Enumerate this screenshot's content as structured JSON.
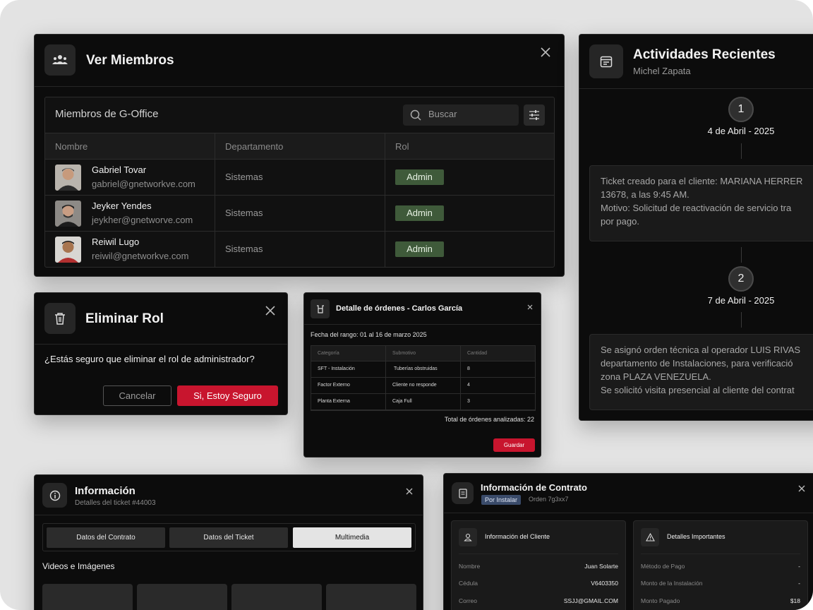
{
  "members": {
    "title": "Ver Miembros",
    "card_title": "Miembros de G-Office",
    "search_placeholder": "Buscar",
    "columns": [
      "Nombre",
      "Departamento",
      "Rol"
    ],
    "rows": [
      {
        "name": "Gabriel Tovar",
        "email": "gabriel@gnetworkve.com",
        "department": "Sistemas",
        "role": "Admin"
      },
      {
        "name": "Jeyker Yendes",
        "email": "jeykher@gnetworve.com",
        "department": "Sistemas",
        "role": "Admin"
      },
      {
        "name": "Reiwil Lugo",
        "email": "reiwil@gnetworkve.com",
        "department": "Sistemas",
        "role": "Admin"
      }
    ]
  },
  "delete_role": {
    "title": "Eliminar Rol",
    "question": "¿Estás seguro que eliminar el rol de administrador?",
    "cancel_label": "Cancelar",
    "confirm_label": "Si, Estoy Seguro"
  },
  "order_detail": {
    "title": "Detalle de órdenes - Carlos García",
    "range": "Fecha del rango: 01 al 16 de marzo 2025",
    "columns": [
      "Categoría",
      "Submotivo",
      "Cantidad"
    ],
    "rows": [
      {
        "category": "SFT - Instalación",
        "submotive": "Tuberías obstruidas",
        "qty": "8"
      },
      {
        "category": "Factor Externo",
        "submotive": "Cliente no responde",
        "qty": "4"
      },
      {
        "category": "Planta Externa",
        "submotive": "Caja Full",
        "qty": "3"
      }
    ],
    "total": "Total de órdenes analizadas: 22",
    "save_label": "Guardar"
  },
  "activities": {
    "title": "Actividades Recientes",
    "subtitle": "Michel Zapata",
    "steps": [
      {
        "number": "1",
        "date": "4 de Abril - 2025",
        "text": "Ticket creado para el cliente: MARIANA HERRER\n13678, a las 9:45 AM.\nMotivo: Solicitud de reactivación de servicio tra\npor pago."
      },
      {
        "number": "2",
        "date": "7 de Abril - 2025",
        "text": "Se asignó orden técnica al operador LUIS RIVAS\ndepartamento de Instalaciones, para verificació\nzona PLAZA VENEZUELA.\nSe solicitó visita presencial al cliente del contrat"
      }
    ]
  },
  "info": {
    "title": "Información",
    "subtitle": "Detalles del ticket #44003",
    "tabs": [
      "Datos del Contrato",
      "Datos del Ticket",
      "Multimedia"
    ],
    "active_tab": "Multimedia",
    "section": "Videos e Imágenes"
  },
  "contract": {
    "title": "Información de Contrato",
    "status": "Por Instalar",
    "order": "Orden 7g3xx7",
    "client_card": {
      "title": "Información del Cliente",
      "fields": [
        {
          "key": "Nombre",
          "value": "Juan Solarte"
        },
        {
          "key": "Cédula",
          "value": "V6403350"
        },
        {
          "key": "Correo",
          "value": "SSJJ@GMAIL.COM"
        }
      ]
    },
    "details_card": {
      "title": "Detalles Importantes",
      "fields": [
        {
          "key": "Método de Pago",
          "value": "-"
        },
        {
          "key": "Monto de la Instalación",
          "value": "-"
        },
        {
          "key": "Monto Pagado",
          "value": "$18"
        }
      ]
    }
  },
  "colors": {
    "panel_bg": "#0c0c0c",
    "admin_badge": "#3f5a3a",
    "danger": "#c8152e",
    "status_badge": "#3a4b6a"
  }
}
